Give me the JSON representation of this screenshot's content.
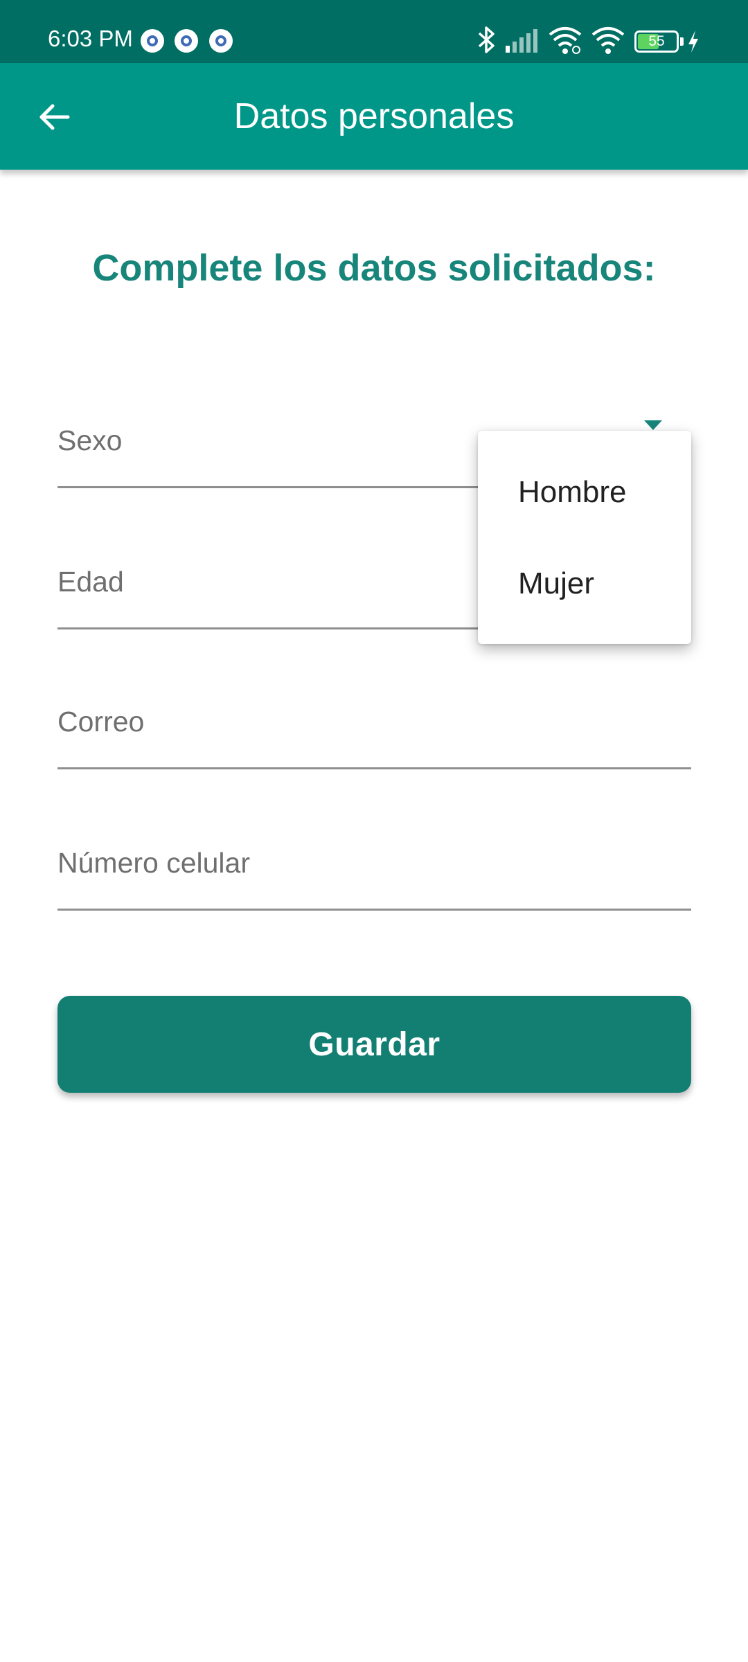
{
  "status_bar": {
    "time": "6:03 PM",
    "battery_level": "55",
    "notification_icons": [
      "app-notification-icon",
      "app-notification-icon",
      "app-notification-icon"
    ],
    "system_icons": [
      "bluetooth-icon",
      "signal-icon",
      "wifi-icon",
      "wifi-icon",
      "battery-icon",
      "charging-icon"
    ]
  },
  "app_bar": {
    "title": "Datos personales",
    "back_icon": "arrow-left-icon"
  },
  "form": {
    "heading": "Complete los datos solicitados:",
    "fields": {
      "sexo": "Sexo",
      "edad": "Edad",
      "correo": "Correo",
      "celular": "Número celular"
    },
    "save_label": "Guardar"
  },
  "dropdown": {
    "options": [
      "Hombre",
      "Mujer"
    ]
  },
  "colors": {
    "status_bar": "#006e63",
    "app_bar": "#009788",
    "accent": "#17857a",
    "button": "#137f73"
  }
}
